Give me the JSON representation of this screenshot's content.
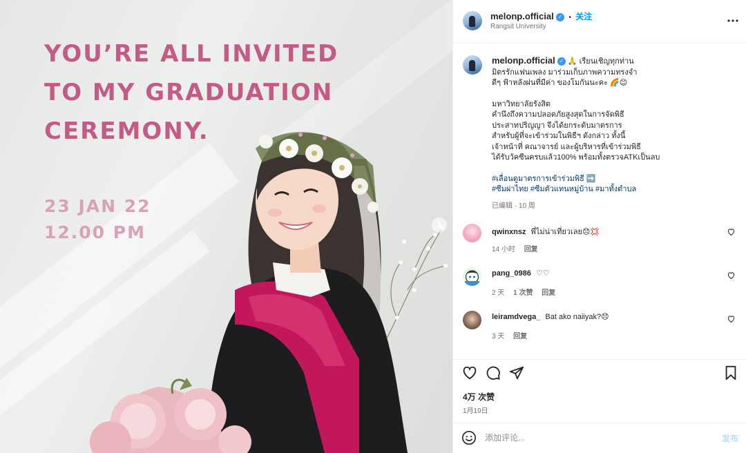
{
  "media": {
    "title_lines": [
      "YOU’RE ALL INVITED",
      "TO MY GRADUATION",
      "CEREMONY."
    ],
    "date": "23 JAN 22",
    "time": "12.00 PM",
    "next_icon": "chevron-right-icon"
  },
  "header": {
    "username": "melonp.official",
    "verified_icon": "verified-badge-icon",
    "separator": "•",
    "follow_label": "关注",
    "location": "Rangsit University",
    "more_icon": "more-horizontal-icon"
  },
  "caption": {
    "username": "melonp.official",
    "first_line": "🙏 เรียนเชิญทุกท่าน",
    "lines": [
      "มิตรรักแฟนเพลง มาร่วมเก็บภาพความทรงจำ",
      "ดีๆ ฟ้าหลังฝนที่มีค่า ของโมกันนะคะ 🌈😊"
    ],
    "paragraph2": [
      "มหาวิทยาลัยรังสิต",
      "คำนึงถึงความปลอดภัยสูงสุดในการจัดพิธี",
      "ประสาทปริญญา จึงได้ยกระดับมาตรการ",
      "สำหรับผู้ที่จะเข้าร่วมในพิธีฯ ดังกล่าว ทั้งนี้",
      "เจ้าหน้าที่ คณาจารย์ และผู้บริหารที่เข้าร่วมพิธี",
      "ได้รับวัคซีนครบแล้ว100% พร้อมทั้งตรวจATKเป็นลบ"
    ],
    "hashtag_line1": "#เลื่อนดูมาตรการเข้าร่วมพิธี ➡️",
    "hashtag_line2": "#ซีมผ่าไทย #ซีมตัวแทนหมู่บ้าน #มาทั้งตำบล",
    "edited_meta": "已编辑 · 10 周"
  },
  "comments": [
    {
      "username": "qwinxnsz",
      "text": "พี่ไม่น่าเที่ยวเลย😞💢",
      "time": "14 小时",
      "likes": "",
      "reply": "回复"
    },
    {
      "username": "pang_0986",
      "text": "♡♡",
      "time": "2 天",
      "likes": "1 次赞",
      "reply": "回复"
    },
    {
      "username": "leiramdvega_",
      "text": "Bat ako naiiyak?😞",
      "time": "3 天",
      "likes": "",
      "reply": "回复"
    }
  ],
  "actions": {
    "like_icon": "heart-icon",
    "comment_icon": "comment-icon",
    "share_icon": "send-icon",
    "save_icon": "bookmark-icon",
    "likes_count": "4万 次赞",
    "date": "1月19日"
  },
  "composer": {
    "emoji_icon": "emoji-icon",
    "placeholder": "添加评论...",
    "post_label": "发布"
  },
  "colors": {
    "title_pink": "#c25c86",
    "date_pink": "#d9a2bb",
    "link_blue": "#0095f6",
    "hashtag_blue": "#00376b",
    "gown_magenta": "#c2185b"
  }
}
